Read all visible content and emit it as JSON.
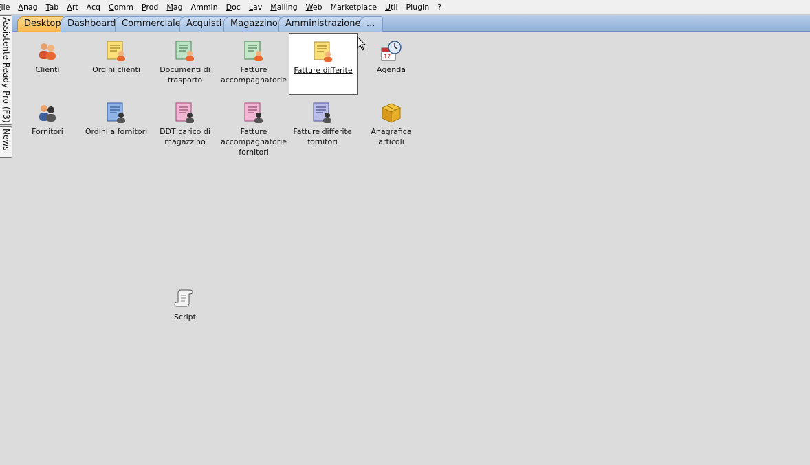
{
  "menu": [
    {
      "label": "File",
      "acc": "F",
      "rest": "ile"
    },
    {
      "label": "Anag",
      "acc": "A",
      "rest": "nag"
    },
    {
      "label": "Tab",
      "acc": "T",
      "rest": "ab"
    },
    {
      "label": "Art",
      "acc": "A",
      "rest": "rt"
    },
    {
      "label": "Acq",
      "acc": "",
      "rest": "Acq"
    },
    {
      "label": "Comm",
      "acc": "C",
      "rest": "omm"
    },
    {
      "label": "Prod",
      "acc": "P",
      "rest": "rod"
    },
    {
      "label": "Mag",
      "acc": "M",
      "rest": "ag"
    },
    {
      "label": "Ammin",
      "acc": "",
      "rest": "Ammin"
    },
    {
      "label": "Doc",
      "acc": "D",
      "rest": "oc"
    },
    {
      "label": "Lav",
      "acc": "L",
      "rest": "av"
    },
    {
      "label": "Mailing",
      "acc": "M",
      "rest": "ailing"
    },
    {
      "label": "Web",
      "acc": "W",
      "rest": "eb"
    },
    {
      "label": "Marketplace",
      "acc": "",
      "rest": "Marketplace"
    },
    {
      "label": "Util",
      "acc": "U",
      "rest": "til"
    },
    {
      "label": "Plugin",
      "acc": "",
      "rest": "Plugin"
    },
    {
      "label": "?",
      "acc": "",
      "rest": "?"
    }
  ],
  "sidebar": {
    "assistente": "Assistente Ready Pro (F3)",
    "news": "News"
  },
  "tabs": [
    "Desktop",
    "Dashboard",
    "Commerciale",
    "Acquisti",
    "Magazzino",
    "Amministrazione",
    "..."
  ],
  "icons": {
    "clienti": "Clienti",
    "ordini_clienti": "Ordini clienti",
    "documenti_trasporto": [
      "Documenti di",
      "trasporto"
    ],
    "fatture_accompagnatorie": [
      "Fatture",
      "accompagnatorie"
    ],
    "fatture_differite": "Fatture differite",
    "agenda": "Agenda",
    "fornitori": "Fornitori",
    "ordini_fornitori": "Ordini a fornitori",
    "ddt_carico": [
      "DDT carico di",
      "magazzino"
    ],
    "fatture_acc_fornitori": [
      "Fatture",
      "accompagnatorie",
      "fornitori"
    ],
    "fatture_diff_fornitori": [
      "Fatture differite",
      "fornitori"
    ],
    "anagrafica_articoli": "Anagrafica articoli",
    "script": "Script"
  },
  "colors": {
    "active_tab": "#f7b64b",
    "tab_strip": "#8fb0d8",
    "desktop_bg": "#dcdcdc"
  }
}
